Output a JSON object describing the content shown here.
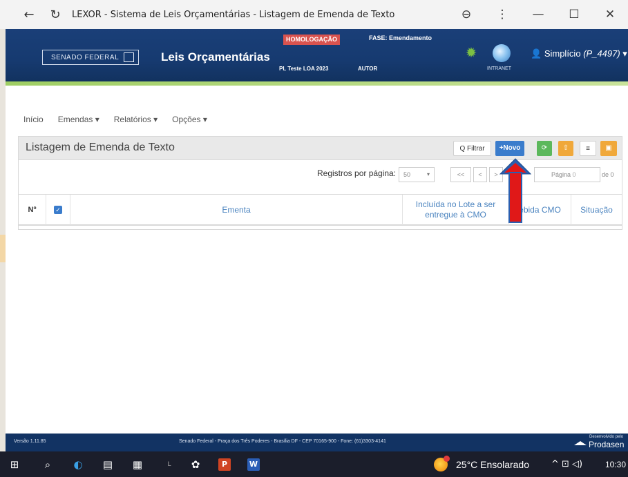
{
  "browser": {
    "back_icon": "←",
    "reload_icon": "↻",
    "title": "LEXOR - Sistema de Leis Orçamentárias - Listagem de Emenda de Texto",
    "zoom_icon": "⊖",
    "menu_icon": "⋮",
    "minimize_icon": "—",
    "maximize_icon": "☐",
    "close_icon": "✕"
  },
  "header": {
    "senado_label": "SENADO FEDERAL",
    "app_name": "Leis Orçamentárias",
    "environment_badge": "HOMOLOGAÇÃO",
    "fase_label": "FASE: Emendamento",
    "pl_label": "PL Teste LOA 2023",
    "autor_label": "AUTOR",
    "intranet_label": "INTRANET",
    "user_icon": "👤",
    "user_name": "Simplício",
    "user_id": "(P_4497)",
    "user_caret": "▾",
    "gear_icon": "✹"
  },
  "menu": {
    "items": [
      "Início",
      "Emendas ▾",
      "Relatórios ▾",
      "Opções ▾"
    ]
  },
  "panel": {
    "title": "Listagem de Emenda de Texto",
    "filtrar_label": "Q Filtrar",
    "novo_label": "+Novo",
    "refresh_icon": "⟳",
    "upload_icon": "⇧",
    "list_icon": "≡",
    "export_icon": "▣"
  },
  "pagination": {
    "label": "Registros por página:",
    "per_page": "50",
    "caret": "▾",
    "first": "<<",
    "prev": "<",
    "next": ">",
    "page_label": "Página",
    "page_value": "0",
    "of_label": "de 0"
  },
  "table": {
    "headers": {
      "n": "Nº",
      "check": "✓",
      "ementa": "Ementa",
      "lote": "Incluída no Lote a ser entregue à CMO",
      "recebida": "ebida CMO",
      "situacao": "Situação"
    }
  },
  "footer": {
    "version": "Versão 1.11.85",
    "address": "Senado Federal - Praça dos Três Poderes - Brasília DF - CEP 70165-900 - Fone: (61)3303-4141",
    "developed_by": "Desenvolvido pelo",
    "prodasen": "Prodasen"
  },
  "taskbar": {
    "windows_icon": "⊞",
    "search_icon": "⌕",
    "edge_icon": "◐",
    "files_icon": "▤",
    "store_icon": "▦",
    "app5_icon": "L",
    "settings_icon": "✿",
    "powerpoint_icon": "P",
    "word_icon": "W",
    "weather_text": "25°C  Ensolarado",
    "tray_icons": "^  ⊡  ◁)",
    "clock": "10:30"
  },
  "colors": {
    "header_blue": "#163a70",
    "novo_blue": "#3a7ccc",
    "badge_red": "#d9534f",
    "arrow_red": "#e01818",
    "arrow_blue": "#2a5fb0"
  }
}
